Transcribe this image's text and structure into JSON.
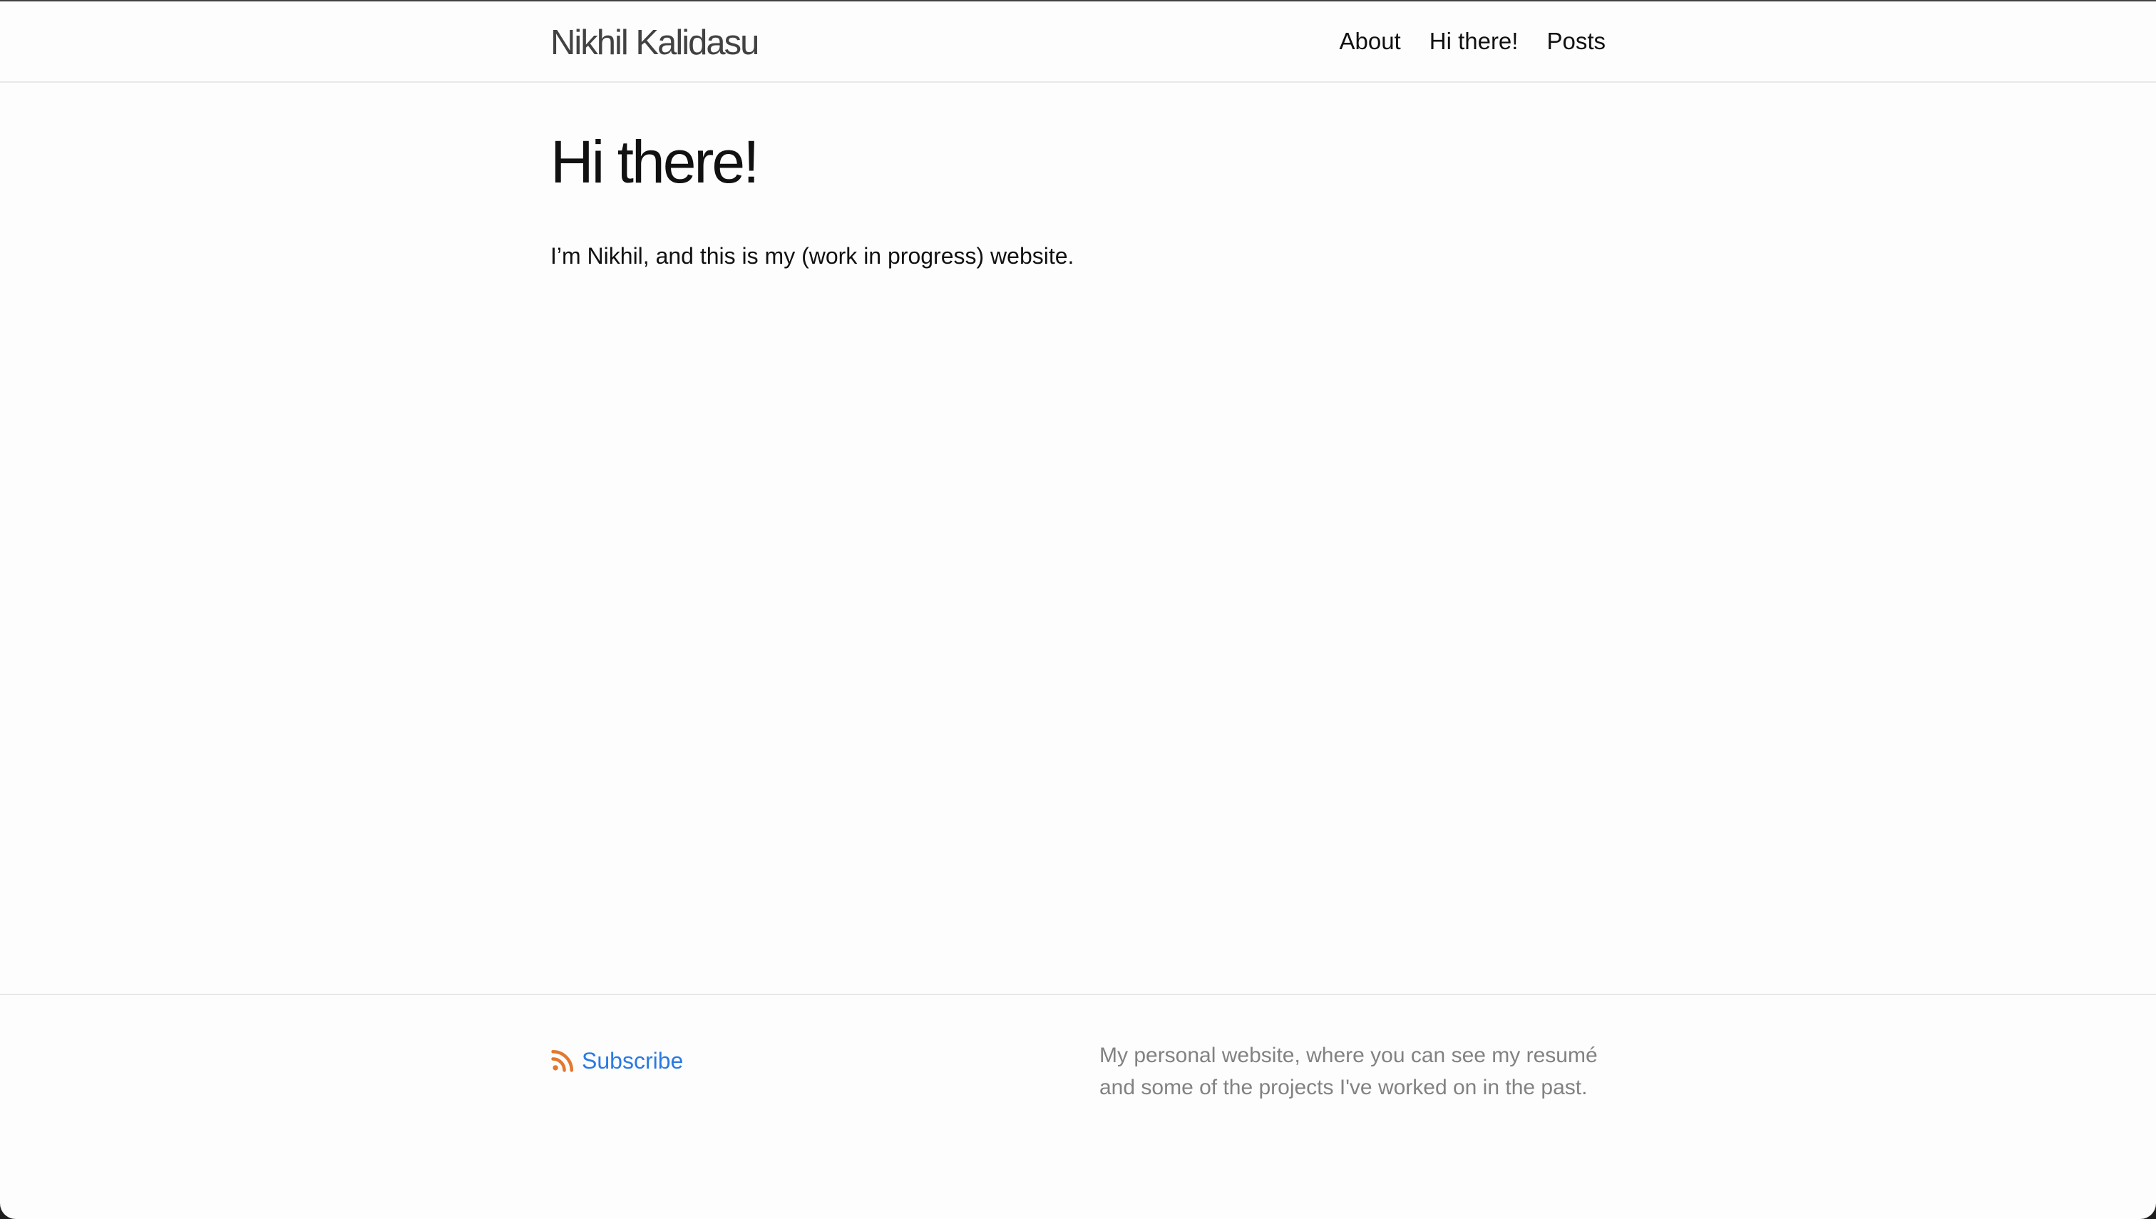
{
  "header": {
    "site_title": "Nikhil Kalidasu",
    "nav": [
      {
        "label": "About"
      },
      {
        "label": "Hi there!"
      },
      {
        "label": "Posts"
      }
    ]
  },
  "main": {
    "heading": "Hi there!",
    "intro": "I’m Nikhil, and this is my (work in progress) website."
  },
  "footer": {
    "subscribe_label": "Subscribe",
    "subscribe_icon": "rss-icon",
    "description": "My personal website, where you can see my resumé and some of the projects I've worked on in the past."
  },
  "colors": {
    "page_background": "#fdfdfd",
    "text": "#111111",
    "site_title": "#424242",
    "link": "#2a7ae2",
    "footer_text": "#828282",
    "rss": "#e3782f",
    "divider": "#e8e8e8"
  }
}
